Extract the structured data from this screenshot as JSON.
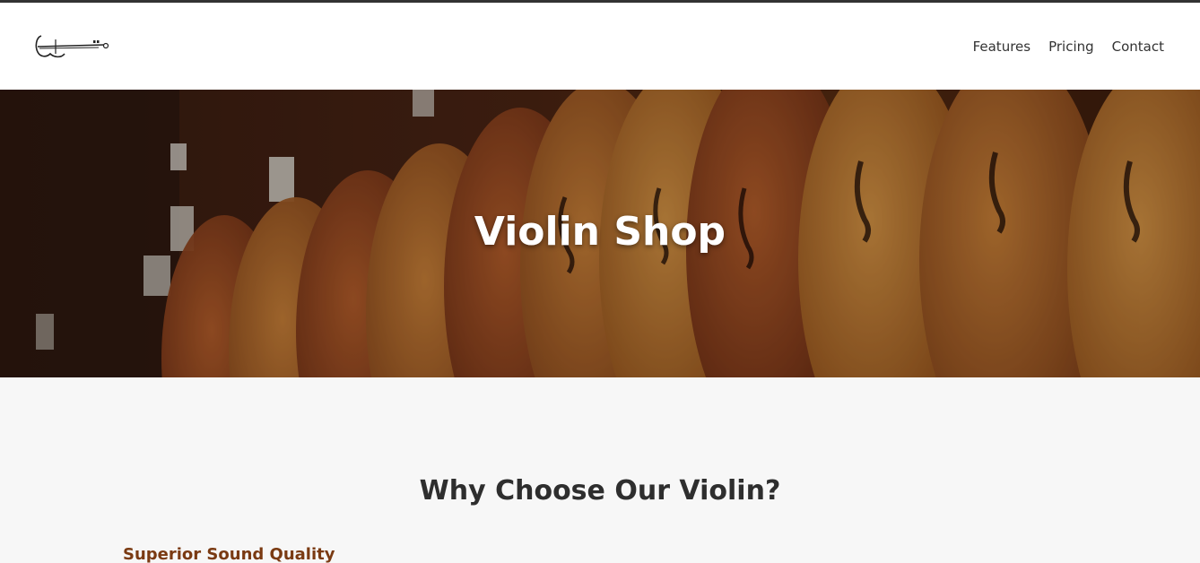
{
  "header": {
    "logo_icon": "violin-logo-icon",
    "nav": [
      {
        "label": "Features"
      },
      {
        "label": "Pricing"
      },
      {
        "label": "Contact"
      }
    ]
  },
  "hero": {
    "title": "Violin Shop",
    "background": "violins-display-photo"
  },
  "features": {
    "section_title": "Why Choose Our Violin?",
    "items": [
      {
        "title": "Superior Sound Quality"
      }
    ]
  },
  "colors": {
    "accent": "#7a3a12",
    "text": "#2e2e2e",
    "page_bg": "#f7f7f7"
  }
}
